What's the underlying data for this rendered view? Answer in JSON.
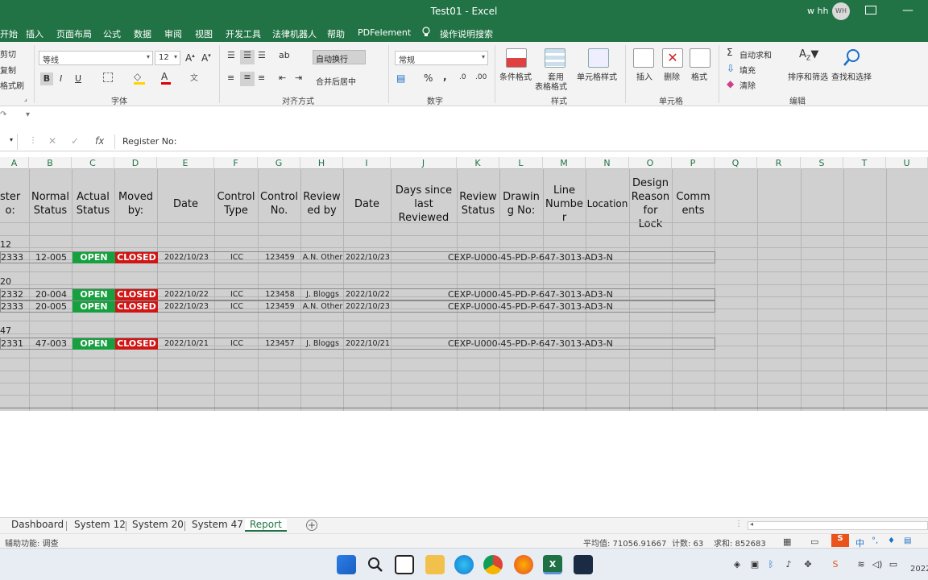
{
  "window": {
    "title": "Test01  -  Excel",
    "user_name": "w hh",
    "avatar_initials": "WH"
  },
  "menu": {
    "tabs": [
      "开始",
      "插入",
      "页面布局",
      "公式",
      "数据",
      "审阅",
      "视图",
      "开发工具",
      "法律机器人",
      "帮助",
      "PDFelement"
    ],
    "search": "操作说明搜索"
  },
  "ribbon": {
    "clipboard": {
      "cut": "剪切",
      "copy": "复制",
      "format_painter": "格式刷"
    },
    "font": {
      "name": "等线",
      "size": "12",
      "group": "字体",
      "bold": "B",
      "italic": "I",
      "underline": "U"
    },
    "alignment": {
      "wrap": "自动换行",
      "merge": "合并后居中",
      "group": "对齐方式"
    },
    "number": {
      "format": "常规",
      "percent": "%",
      "comma": ",",
      "group": "数字"
    },
    "styles": {
      "conditional": "条件格式",
      "table_line1": "套用",
      "table_line2": "表格格式",
      "cell_styles": "单元格样式",
      "group": "样式"
    },
    "cells": {
      "insert": "插入",
      "delete": "删除",
      "format": "格式",
      "group": "单元格"
    },
    "editing": {
      "autosum": "自动求和",
      "fill": "填充",
      "clear": "清除",
      "sort": "排序和筛选",
      "find": "查找和选择",
      "group": "编辑"
    }
  },
  "formula_bar": {
    "fx": "fx",
    "content": "Register No:"
  },
  "columns": [
    "A",
    "B",
    "C",
    "D",
    "E",
    "F",
    "G",
    "H",
    "I",
    "J",
    "K",
    "L",
    "M",
    "N",
    "O",
    "P",
    "Q",
    "R",
    "S",
    "T",
    "U"
  ],
  "headers": {
    "register": "ster\no:",
    "normal_status": "Normal\nStatus",
    "actual_status": "Actual\nStatus",
    "moved_by": "Moved\nby:",
    "date": "Date",
    "control_type": "Control\nType",
    "control_no": "Control\nNo.",
    "reviewed_by": "Review\ned by",
    "date2": "Date",
    "days_since": "Days since\nlast\nReviewed",
    "review_status": "Review\nStatus",
    "drawing_no": "Drawin\ng No:",
    "line_number": "Line\nNumbe\nr",
    "location": "Location",
    "design_reason": "Design\nReason\nfor\nLock",
    "comments": "Comm\nents"
  },
  "groups": [
    {
      "label": "12",
      "rows": [
        {
          "reg": "2333",
          "normal": "12-005",
          "actual": "OPEN",
          "moved": "CLOSED",
          "date": "2022/10/23",
          "ctype": "ICC",
          "cno": "123459",
          "reviewed": "A.N. Other",
          "date2": "2022/10/23",
          "drawing": "CEXP-U000-45-PD-P-6",
          "line": "47-3013-AD3-N"
        }
      ]
    },
    {
      "label": "20",
      "rows": [
        {
          "reg": "2332",
          "normal": "20-004",
          "actual": "OPEN",
          "moved": "CLOSED",
          "date": "2022/10/22",
          "ctype": "ICC",
          "cno": "123458",
          "reviewed": "J. Bloggs",
          "date2": "2022/10/22",
          "drawing": "CEXP-U000-45-PD-P-6",
          "line": "47-3013-AD3-N"
        },
        {
          "reg": "2333",
          "normal": "20-005",
          "actual": "OPEN",
          "moved": "CLOSED",
          "date": "2022/10/23",
          "ctype": "ICC",
          "cno": "123459",
          "reviewed": "A.N. Other",
          "date2": "2022/10/23",
          "drawing": "CEXP-U000-45-PD-P-6",
          "line": "47-3013-AD3-N"
        }
      ]
    },
    {
      "label": "47",
      "rows": [
        {
          "reg": "2331",
          "normal": "47-003",
          "actual": "OPEN",
          "moved": "CLOSED",
          "date": "2022/10/21",
          "ctype": "ICC",
          "cno": "123457",
          "reviewed": "J. Bloggs",
          "date2": "2022/10/21",
          "drawing": "CEXP-U000-45-PD-P-6",
          "line": "47-3013-AD3-N"
        }
      ]
    }
  ],
  "sheet_tabs": [
    "Dashboard",
    "System 12",
    "System 20",
    "System 47",
    "Report"
  ],
  "active_sheet": "Report",
  "status": {
    "accessibility": "辅助功能: 调查",
    "average": "平均值: 71056.91667",
    "count": "计数: 63",
    "sum": "求和: 852683"
  },
  "taskbar": {
    "clock": "2022"
  },
  "colors": {
    "excel_green": "#217346",
    "open": "#17a040",
    "closed": "#d01515"
  }
}
